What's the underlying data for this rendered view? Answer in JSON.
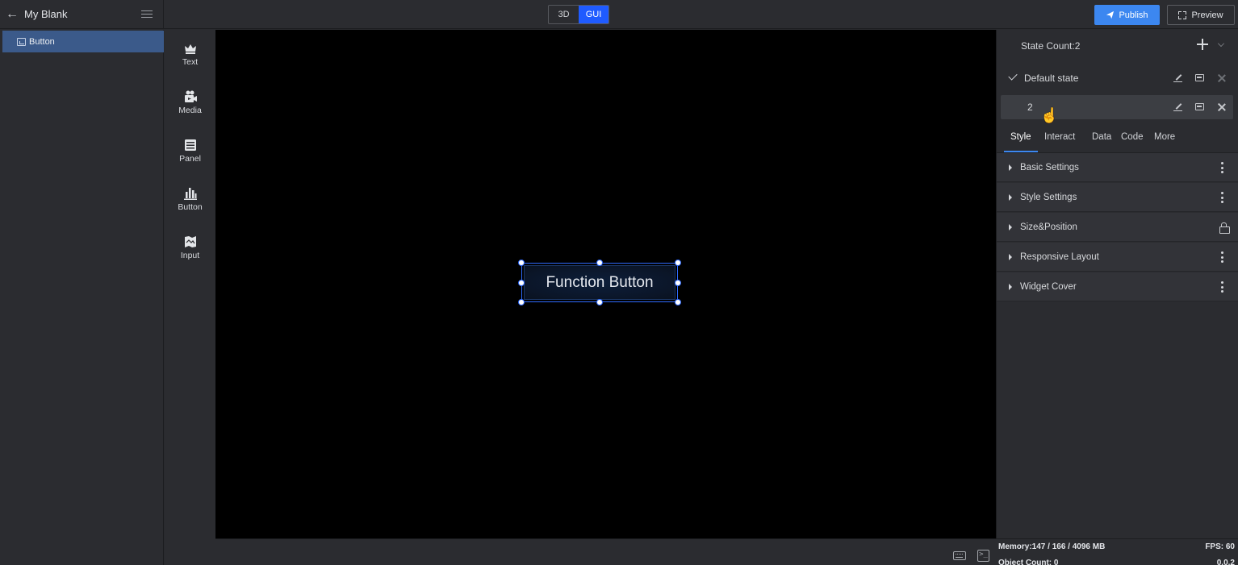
{
  "app": {
    "title": "My Blank",
    "modes": [
      "3D",
      "GUI"
    ],
    "active_mode": "GUI",
    "publish_label": "Publish",
    "preview_label": "Preview",
    "accent": "#1f5bff",
    "publish_color": "#3c87f0"
  },
  "layers": {
    "items": [
      {
        "label": "Button",
        "selected": true
      }
    ]
  },
  "toolbox": {
    "items": [
      {
        "label": "Text",
        "icon": "crown-icon"
      },
      {
        "label": "Media",
        "icon": "camera-icon"
      },
      {
        "label": "Panel",
        "icon": "panel-icon"
      },
      {
        "label": "Button",
        "icon": "bar-chart-icon"
      },
      {
        "label": "Input",
        "icon": "input-icon"
      }
    ]
  },
  "canvas": {
    "widget_label": "Function Button"
  },
  "states": {
    "count_label": "State Count:2",
    "items": [
      {
        "name": "Default state",
        "checked": true
      },
      {
        "name": "2",
        "checked": false,
        "hovered": true
      }
    ]
  },
  "tabs": {
    "items": [
      "Style",
      "Interact",
      "Data",
      "Code",
      "More"
    ],
    "active": "Style"
  },
  "sections": [
    {
      "label": "Basic Settings",
      "action_icon": "more-vertical-icon"
    },
    {
      "label": "Style Settings",
      "action_icon": "more-vertical-icon"
    },
    {
      "label": "Size&Position",
      "action_icon": "lock-icon"
    },
    {
      "label": "Responsive Layout",
      "action_icon": "more-vertical-icon"
    },
    {
      "label": "Widget Cover",
      "action_icon": "more-vertical-icon"
    }
  ],
  "status": {
    "memory": "Memory:147 / 166 / 4096 MB",
    "fps": "FPS: 60",
    "object_count": "Object Count: 0",
    "version": "0.0.2"
  }
}
